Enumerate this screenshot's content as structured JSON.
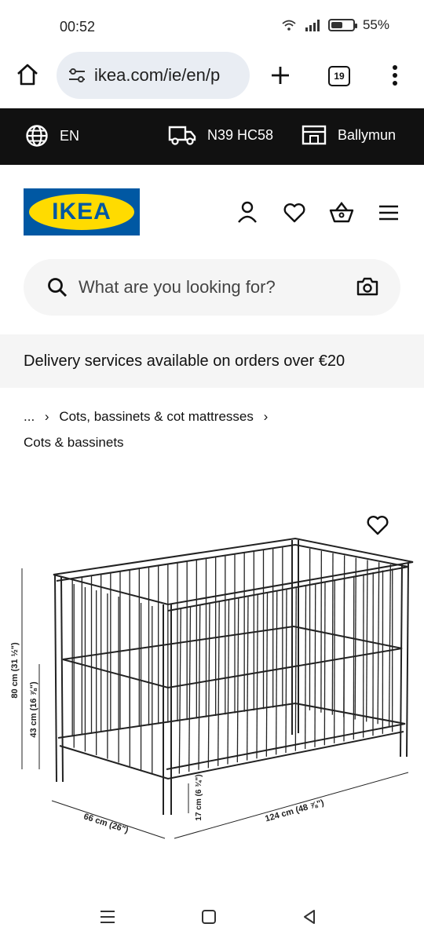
{
  "status_bar": {
    "time": "00:52",
    "battery": "55%",
    "battery_level": 0.55
  },
  "browser": {
    "url": "ikea.com/ie/en/p",
    "tab_count": "19"
  },
  "top_bar": {
    "language": "EN",
    "postcode": "N39 HC58",
    "store": "Ballymun"
  },
  "header": {
    "logo_text": "IKEA"
  },
  "search": {
    "placeholder": "What are you looking for?"
  },
  "banner": {
    "text": "Delivery services available on orders over €20"
  },
  "breadcrumb": {
    "ellipsis": "...",
    "parent": "Cots, bassinets & cot mattresses",
    "current": "Cots & bassinets"
  },
  "product_image": {
    "dim_height": "80 cm (31 ½\")",
    "dim_mattress_height": "43 cm (16 ⅞\")",
    "dim_width": "66 cm (26\")",
    "dim_length": "124 cm (48 ⅞\")",
    "dim_clearance": "17 cm (6 ¾\")"
  },
  "colors": {
    "ikea_blue": "#0058a3",
    "ikea_yellow": "#ffdb00",
    "dark_bar": "#111111"
  }
}
